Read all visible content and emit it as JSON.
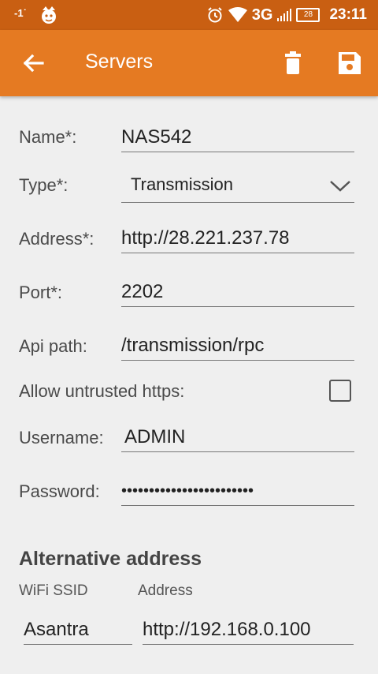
{
  "status_bar": {
    "signal_left": "-1˙",
    "network": "3G",
    "battery": "28",
    "time": "23:11"
  },
  "app_bar": {
    "title": "Servers",
    "back_icon": "arrow-back-icon",
    "delete_icon": "trash-icon",
    "save_icon": "save-floppy-icon"
  },
  "form": {
    "name": {
      "label": "Name*:",
      "value": "NAS542"
    },
    "type": {
      "label": "Type*:",
      "value": "Transmission"
    },
    "address": {
      "label": "Address*:",
      "value": "http://28.221.237.78"
    },
    "port": {
      "label": "Port*:",
      "value": "2202"
    },
    "api_path": {
      "label": "Api path:",
      "value": "/transmission/rpc"
    },
    "allow_untrusted": {
      "label": "Allow untrusted https:",
      "checked": false
    },
    "username": {
      "label": "Username:",
      "value": "ADMIN"
    },
    "password": {
      "label": "Password:",
      "value": "••••••••••••••••••••••••"
    }
  },
  "alternative": {
    "section_title": "Alternative address",
    "wifi_label": "WiFi SSID",
    "address_label": "Address",
    "wifi_value": "Asantra",
    "address_value": "http://192.168.0.100"
  },
  "colors": {
    "status_bar": "#c95f12",
    "app_bar": "#e57a22",
    "background": "#efefef"
  }
}
